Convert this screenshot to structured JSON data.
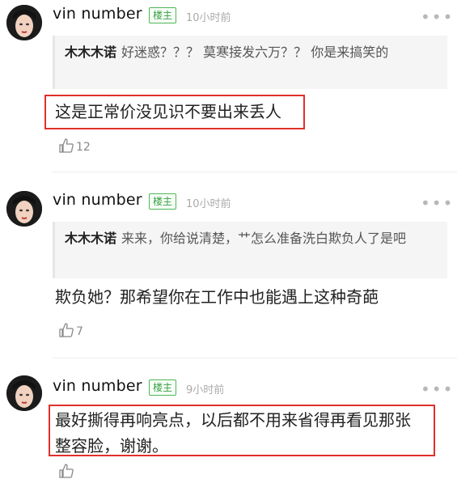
{
  "comments": [
    {
      "username": "vin number",
      "badge": "楼主",
      "time": "10小时前",
      "quote_name": "木木木诺",
      "quote_text": "好迷惑？？？ 莫寒接发六万？？ 你是来搞笑的",
      "text": "这是正常价没见识不要出来丢人",
      "likes": "12",
      "more": "•••"
    },
    {
      "username": "vin number",
      "badge": "楼主",
      "time": "10小时前",
      "quote_name": "木木木诺",
      "quote_text": "来来，你给说清楚，艹怎么准备洗白欺负人了是吧",
      "text": "欺负她？那希望你在工作中也能遇上这种奇葩",
      "likes": "7",
      "more": "•••"
    },
    {
      "username": "vin number",
      "badge": "楼主",
      "time": "9小时前",
      "text_line1": "最好撕得再响亮点，以后都不用来省得再看见那张",
      "text_line2": "整容脸，谢谢。",
      "more": "•••"
    }
  ],
  "colors": {
    "badge": "#4fb65a",
    "highlight": "#e0302a"
  }
}
